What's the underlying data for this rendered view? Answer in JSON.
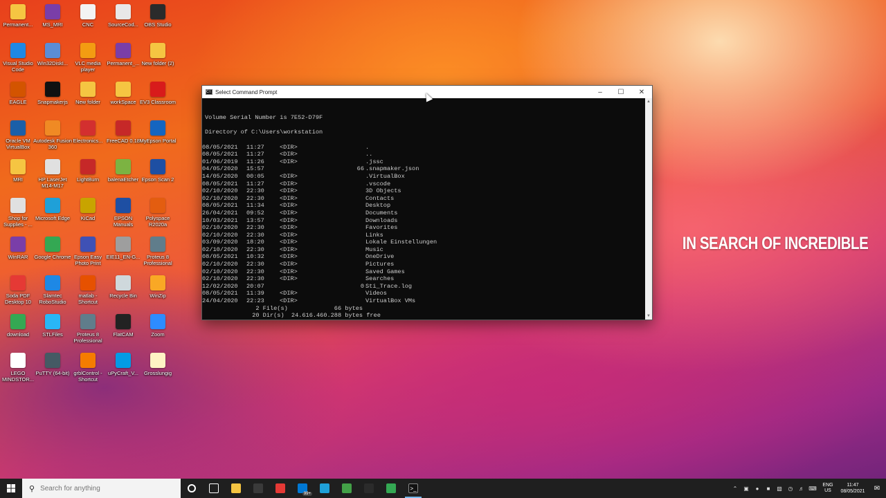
{
  "desktop_icons": [
    {
      "label": "Permanent...",
      "icon": "folder-icon",
      "color": "#f5c542"
    },
    {
      "label": "MS_MRI",
      "icon": "winrar-icon",
      "color": "#7a3ea8"
    },
    {
      "label": "CNC",
      "icon": "file-icon",
      "color": "#f3f3f3"
    },
    {
      "label": "SourceCod...",
      "icon": "text-file-icon",
      "color": "#e8e8e8"
    },
    {
      "label": "OBS Studio",
      "icon": "obs-icon",
      "color": "#2b2b2b"
    },
    {
      "label": "Visual Studio Code",
      "icon": "vscode-icon",
      "color": "#1e88e5"
    },
    {
      "label": "Win32DiskI...",
      "icon": "disk-imager-icon",
      "color": "#5b8dd6"
    },
    {
      "label": "VLC media player",
      "icon": "vlc-icon",
      "color": "#f39c12"
    },
    {
      "label": "Permanent_...",
      "icon": "winrar-icon",
      "color": "#7a3ea8"
    },
    {
      "label": "New folder (2)",
      "icon": "folder-icon",
      "color": "#f5c542"
    },
    {
      "label": "EAGLE",
      "icon": "eagle-icon",
      "color": "#d35400"
    },
    {
      "label": "Snapmakerjs",
      "icon": "snapmaker-icon",
      "color": "#111111"
    },
    {
      "label": "New folder",
      "icon": "folder-icon",
      "color": "#f5c542"
    },
    {
      "label": "workSpace",
      "icon": "folder-icon",
      "color": "#f5c542"
    },
    {
      "label": "EV3 Classroom",
      "icon": "ev3-icon",
      "color": "#d81b1b"
    },
    {
      "label": "Oracle VM VirtualBox",
      "icon": "virtualbox-icon",
      "color": "#1b5fa8"
    },
    {
      "label": "Autodesk Fusion 360",
      "icon": "fusion-icon",
      "color": "#f08a24"
    },
    {
      "label": "Electronics...",
      "icon": "electronics-icon",
      "color": "#d32f2f"
    },
    {
      "label": "FreeCAD 0.18",
      "icon": "freecad-icon",
      "color": "#c62828"
    },
    {
      "label": "MyEpson Portal",
      "icon": "epson-portal-icon",
      "color": "#1565c0"
    },
    {
      "label": "MRI",
      "icon": "folder-icon",
      "color": "#f5c542"
    },
    {
      "label": "HP LaserJet M14-M17",
      "icon": "printer-icon",
      "color": "#e0e0e0"
    },
    {
      "label": "LightBurn",
      "icon": "lightburn-icon",
      "color": "#c62828"
    },
    {
      "label": "balenaEtcher",
      "icon": "etcher-icon",
      "color": "#7cb342"
    },
    {
      "label": "Epson Scan 2",
      "icon": "scanner-icon",
      "color": "#1e4fa3"
    },
    {
      "label": "Shop for Supplies - ...",
      "icon": "printer-icon",
      "color": "#e0e0e0"
    },
    {
      "label": "Microsoft Edge",
      "icon": "edge-icon",
      "color": "#1fa0d8"
    },
    {
      "label": "KiCad",
      "icon": "kicad-icon",
      "color": "#c8a400"
    },
    {
      "label": "EPSON Manuals",
      "icon": "epson-manual-icon",
      "color": "#1e4fa3"
    },
    {
      "label": "Polyspace R2020a",
      "icon": "polyspace-icon",
      "color": "#e35d10"
    },
    {
      "label": "WinRAR",
      "icon": "winrar-icon",
      "color": "#7a3ea8"
    },
    {
      "label": "Google Chrome",
      "icon": "chrome-icon",
      "color": "#34a853"
    },
    {
      "label": "Epson Easy Photo Print",
      "icon": "epson-photo-icon",
      "color": "#3f51b5"
    },
    {
      "label": "EIE11_EN-G...",
      "icon": "installer-icon",
      "color": "#9e9e9e"
    },
    {
      "label": "Proteus 8 Professional",
      "icon": "proteus-icon",
      "color": "#607d8b"
    },
    {
      "label": "Soda PDF Desktop 10",
      "icon": "soda-pdf-icon",
      "color": "#e53935"
    },
    {
      "label": "Slamtec RoboStudio",
      "icon": "robostudio-icon",
      "color": "#1e88e5"
    },
    {
      "label": "matlab - Shortcut",
      "icon": "matlab-icon",
      "color": "#e65100"
    },
    {
      "label": "Recycle Bin",
      "icon": "recycle-bin-icon",
      "color": "#cfd8dc"
    },
    {
      "label": "WinZip",
      "icon": "winzip-icon",
      "color": "#f9a825"
    },
    {
      "label": "download",
      "icon": "chrome-icon",
      "color": "#34a853"
    },
    {
      "label": "STLFiles",
      "icon": "folder-icon",
      "color": "#29b6f6"
    },
    {
      "label": "Proteus 8 Professional",
      "icon": "proteus-icon",
      "color": "#607d8b"
    },
    {
      "label": "FlatCAM",
      "icon": "flatcam-icon",
      "color": "#222222"
    },
    {
      "label": "Zoom",
      "icon": "zoom-icon",
      "color": "#2d8cff"
    },
    {
      "label": "LEGO MINDSTOR...",
      "icon": "lego-icon",
      "color": "#ffffff"
    },
    {
      "label": "PuTTY (64-bit)",
      "icon": "putty-icon",
      "color": "#455a64"
    },
    {
      "label": "grblControl - Shortcut",
      "icon": "grbl-icon",
      "color": "#f57c00"
    },
    {
      "label": "uPyCraft_V...",
      "icon": "upycraft-icon",
      "color": "#039be5"
    },
    {
      "label": "Grosslungig",
      "icon": "file-icon",
      "color": "#fff3c4"
    }
  ],
  "cmd": {
    "title": "Select Command Prompt",
    "header_lines": [
      "Volume Serial Number is 7E52-D79F",
      "",
      "Directory of C:\\Users\\workstation",
      ""
    ],
    "rows": [
      {
        "date": "08/05/2021",
        "time": "11:27",
        "kind": "<DIR>",
        "size": "",
        "name": "."
      },
      {
        "date": "08/05/2021",
        "time": "11:27",
        "kind": "<DIR>",
        "size": "",
        "name": ".."
      },
      {
        "date": "01/06/2019",
        "time": "11:26",
        "kind": "<DIR>",
        "size": "",
        "name": ".jssc"
      },
      {
        "date": "04/05/2020",
        "time": "15:57",
        "kind": "",
        "size": "66",
        "name": ".snapmaker.json"
      },
      {
        "date": "14/05/2020",
        "time": "00:05",
        "kind": "<DIR>",
        "size": "",
        "name": ".VirtualBox"
      },
      {
        "date": "08/05/2021",
        "time": "11:27",
        "kind": "<DIR>",
        "size": "",
        "name": ".vscode"
      },
      {
        "date": "02/10/2020",
        "time": "22:30",
        "kind": "<DIR>",
        "size": "",
        "name": "3D Objects"
      },
      {
        "date": "02/10/2020",
        "time": "22:30",
        "kind": "<DIR>",
        "size": "",
        "name": "Contacts"
      },
      {
        "date": "08/05/2021",
        "time": "11:34",
        "kind": "<DIR>",
        "size": "",
        "name": "Desktop"
      },
      {
        "date": "26/04/2021",
        "time": "09:52",
        "kind": "<DIR>",
        "size": "",
        "name": "Documents"
      },
      {
        "date": "10/03/2021",
        "time": "13:57",
        "kind": "<DIR>",
        "size": "",
        "name": "Downloads"
      },
      {
        "date": "02/10/2020",
        "time": "22:30",
        "kind": "<DIR>",
        "size": "",
        "name": "Favorites"
      },
      {
        "date": "02/10/2020",
        "time": "22:30",
        "kind": "<DIR>",
        "size": "",
        "name": "Links"
      },
      {
        "date": "03/09/2020",
        "time": "18:20",
        "kind": "<DIR>",
        "size": "",
        "name": "Lokale Einstellungen"
      },
      {
        "date": "02/10/2020",
        "time": "22:30",
        "kind": "<DIR>",
        "size": "",
        "name": "Music"
      },
      {
        "date": "08/05/2021",
        "time": "10:32",
        "kind": "<DIR>",
        "size": "",
        "name": "OneDrive"
      },
      {
        "date": "02/10/2020",
        "time": "22:30",
        "kind": "<DIR>",
        "size": "",
        "name": "Pictures"
      },
      {
        "date": "02/10/2020",
        "time": "22:30",
        "kind": "<DIR>",
        "size": "",
        "name": "Saved Games"
      },
      {
        "date": "02/10/2020",
        "time": "22:30",
        "kind": "<DIR>",
        "size": "",
        "name": "Searches"
      },
      {
        "date": "12/02/2020",
        "time": "20:07",
        "kind": "",
        "size": "0",
        "name": "Sti_Trace.log"
      },
      {
        "date": "08/05/2021",
        "time": "11:39",
        "kind": "<DIR>",
        "size": "",
        "name": "Videos"
      },
      {
        "date": "24/04/2020",
        "time": "22:23",
        "kind": "<DIR>",
        "size": "",
        "name": "VirtualBox VMs"
      }
    ],
    "summary_files": "               2 File(s)             66 bytes",
    "summary_dirs": "              20 Dir(s)  24.616.460.288 bytes free",
    "prompt_selected": "C:",
    "prompt_rest": "\\Users\\workstation>"
  },
  "caption": "IN SEARCH OF INCREDIBLE",
  "taskbar": {
    "search_placeholder": "Search for anything",
    "pinned": [
      {
        "name": "cortana-icon",
        "color": "#1f1f1f"
      },
      {
        "name": "task-view-icon",
        "color": "#1f1f1f"
      },
      {
        "name": "file-explorer-icon",
        "color": "#f5c542"
      },
      {
        "name": "store-icon",
        "color": "#3a3a3a"
      },
      {
        "name": "gift-icon",
        "color": "#e53935"
      },
      {
        "name": "mail-icon",
        "color": "#0078d4"
      },
      {
        "name": "edge-icon",
        "color": "#1fa0d8"
      },
      {
        "name": "edge-old-icon",
        "color": "#43a047"
      },
      {
        "name": "obs-icon",
        "color": "#2b2b2b"
      },
      {
        "name": "chrome-icon",
        "color": "#34a853"
      },
      {
        "name": "cmd-icon",
        "color": "#111111"
      }
    ],
    "mail_badge": "99+",
    "lang_top": "ENG",
    "lang_bottom": "US",
    "time": "11:47",
    "date": "08/05/2021"
  }
}
